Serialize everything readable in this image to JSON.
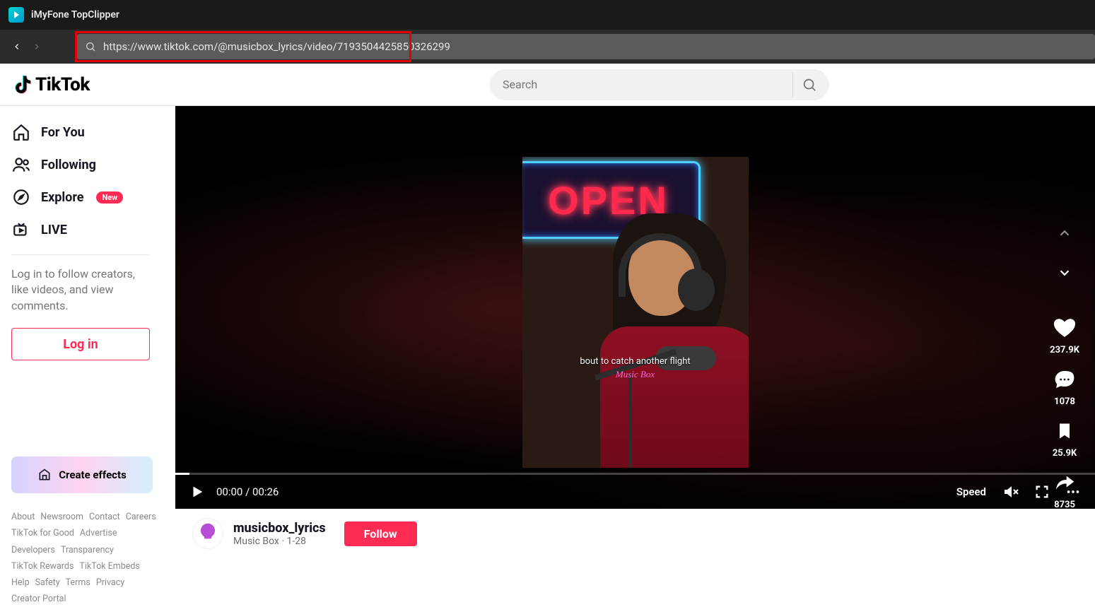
{
  "app": {
    "title": "iMyFone TopClipper"
  },
  "address": {
    "url": "https://www.tiktok.com/@musicbox_lyrics/video/7193504425850326299"
  },
  "tt": {
    "brand": "TikTok",
    "search_placeholder": "Search",
    "sidebar": {
      "items": [
        {
          "label": "For You"
        },
        {
          "label": "Following"
        },
        {
          "label": "Explore",
          "badge": "New"
        },
        {
          "label": "LIVE"
        }
      ],
      "login_prompt": "Log in to follow creators, like videos, and view comments.",
      "login_label": "Log in",
      "create_effects": "Create effects",
      "footer": [
        [
          "About",
          "Newsroom",
          "Contact",
          "Careers"
        ],
        [
          "TikTok for Good",
          "Advertise"
        ],
        [
          "Developers",
          "Transparency"
        ],
        [
          "TikTok Rewards",
          "TikTok Embeds"
        ],
        [
          "Help",
          "Safety",
          "Terms",
          "Privacy"
        ],
        [
          "Creator Portal"
        ]
      ]
    },
    "video": {
      "neon_text": "OPEN",
      "caption": "bout to catch another flight",
      "watermark": "Music Box",
      "time_current": "00:00",
      "time_total": "00:26",
      "speed_label": "Speed",
      "stats": {
        "likes": "237.9K",
        "comments": "1078",
        "saves": "25.9K",
        "shares": "8735"
      }
    },
    "uploader": {
      "username": "musicbox_lyrics",
      "display": "Music Box",
      "date": "1-28",
      "follow": "Follow"
    }
  }
}
